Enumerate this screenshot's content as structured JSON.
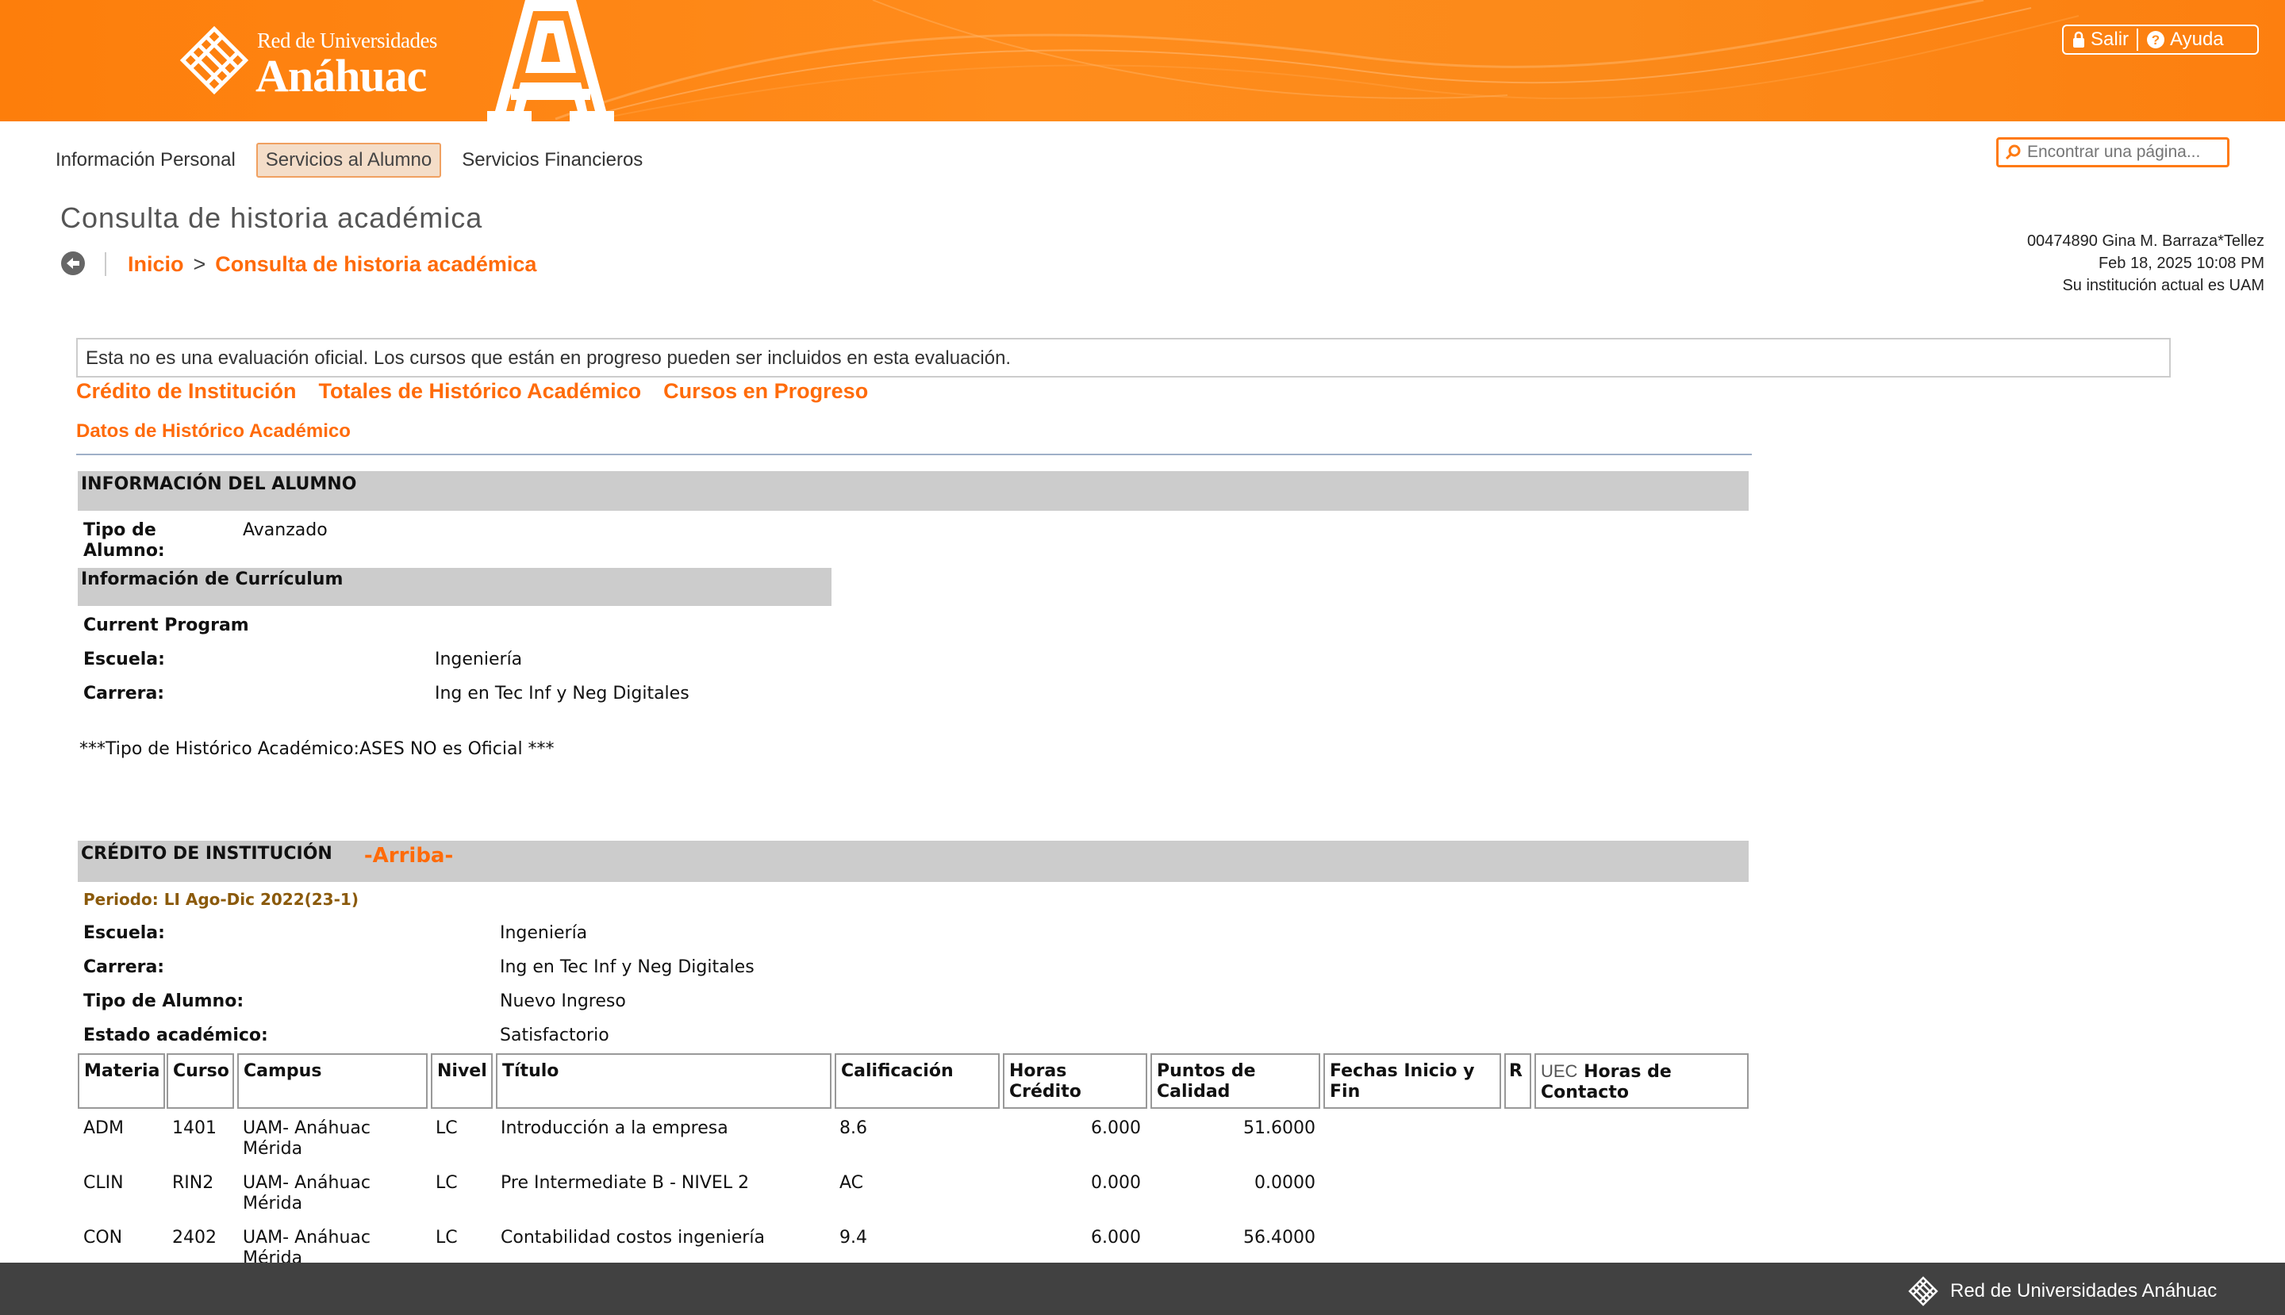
{
  "header": {
    "logo_top": "Red de Universidades",
    "logo_main": "Anáhuac",
    "big_letter": "A",
    "logout_label": "Salir",
    "help_label": "Ayuda",
    "brand_color": "#ff8a1a"
  },
  "nav": {
    "items": [
      {
        "label": "Información Personal"
      },
      {
        "label": "Servicios al Alumno"
      },
      {
        "label": "Servicios Financieros"
      }
    ],
    "active": "Servicios al Alumno"
  },
  "search": {
    "placeholder": "Encontrar una página..."
  },
  "page": {
    "title": "Consulta de historia académica",
    "breadcrumb": {
      "home": "Inicio",
      "separator": ">",
      "current": "Consulta de historia académica"
    }
  },
  "user": {
    "id_name": "00474890 Gina M. Barraza*Tellez",
    "datetime": "Feb 18, 2025 10:08 PM",
    "institution": "Su institución actual es UAM"
  },
  "notice": "Esta no es una evaluación oficial. Los cursos que están en progreso pueden ser incluidos en esta evaluación.",
  "section_links": [
    "Crédito de Institución",
    "Totales de Histórico Académico",
    "Cursos en Progreso"
  ],
  "datos_label": "Datos de Histórico Académico",
  "student_info": {
    "heading": "INFORMACIÓN DEL ALUMNO",
    "tipo_label_1": "Tipo de",
    "tipo_label_2": "Alumno:",
    "tipo_value": "Avanzado",
    "curriculum_heading": "Información de Currículum",
    "current_program": "Current Program",
    "escuela_label": "Escuela:",
    "escuela_value": "Ingeniería",
    "carrera_label": "Carrera:",
    "carrera_value": "Ing en Tec Inf y Neg Digitales",
    "tipo_historico": "***Tipo de Histórico Académico:ASES NO es Oficial ***"
  },
  "institution_credit": {
    "heading": "CRÉDITO DE INSTITUCIÓN",
    "top_link": "-Arriba-",
    "period": "Periodo: LI Ago-Dic 2022(23-1)",
    "fields": [
      {
        "label": "Escuela:",
        "value": "Ingeniería"
      },
      {
        "label": "Carrera:",
        "value": "Ing en Tec Inf y Neg Digitales"
      },
      {
        "label": "Tipo de Alumno:",
        "value": "Nuevo Ingreso"
      },
      {
        "label": "Estado académico:",
        "value": "Satisfactorio"
      }
    ],
    "columns": {
      "materia": "Materia",
      "curso": "Curso",
      "campus": "Campus",
      "nivel": "Nivel",
      "titulo": "Título",
      "calificacion": "Calificación",
      "horas_credito": "Horas Crédito",
      "puntos_1": "Puntos de",
      "puntos_2": "Calidad",
      "fechas_1": "Fechas Inicio y",
      "fechas_2": "Fin",
      "r": "R",
      "uec": "UEC",
      "horas_contacto_1": "Horas de",
      "horas_contacto_2": "Contacto"
    },
    "rows": [
      {
        "materia": "ADM",
        "curso": "1401",
        "campus_1": "UAM- Anáhuac",
        "campus_2": "Mérida",
        "nivel": "LC",
        "titulo": "Introducción a la empresa",
        "calificacion": "8.6",
        "horas_credito": "6.000",
        "puntos": "51.6000"
      },
      {
        "materia": "CLIN",
        "curso": "RIN2",
        "campus_1": "UAM- Anáhuac",
        "campus_2": "Mérida",
        "nivel": "LC",
        "titulo": "Pre Intermediate B - NIVEL 2",
        "calificacion": "AC",
        "horas_credito": "0.000",
        "puntos": "0.0000"
      },
      {
        "materia": "CON",
        "curso": "2402",
        "campus_1": "UAM- Anáhuac",
        "campus_2": "Mérida",
        "nivel": "LC",
        "titulo": "Contabilidad costos ingeniería",
        "calificacion": "9.4",
        "horas_credito": "6.000",
        "puntos": "56.4000"
      }
    ]
  },
  "footer": {
    "text": "Red de Universidades Anáhuac"
  }
}
